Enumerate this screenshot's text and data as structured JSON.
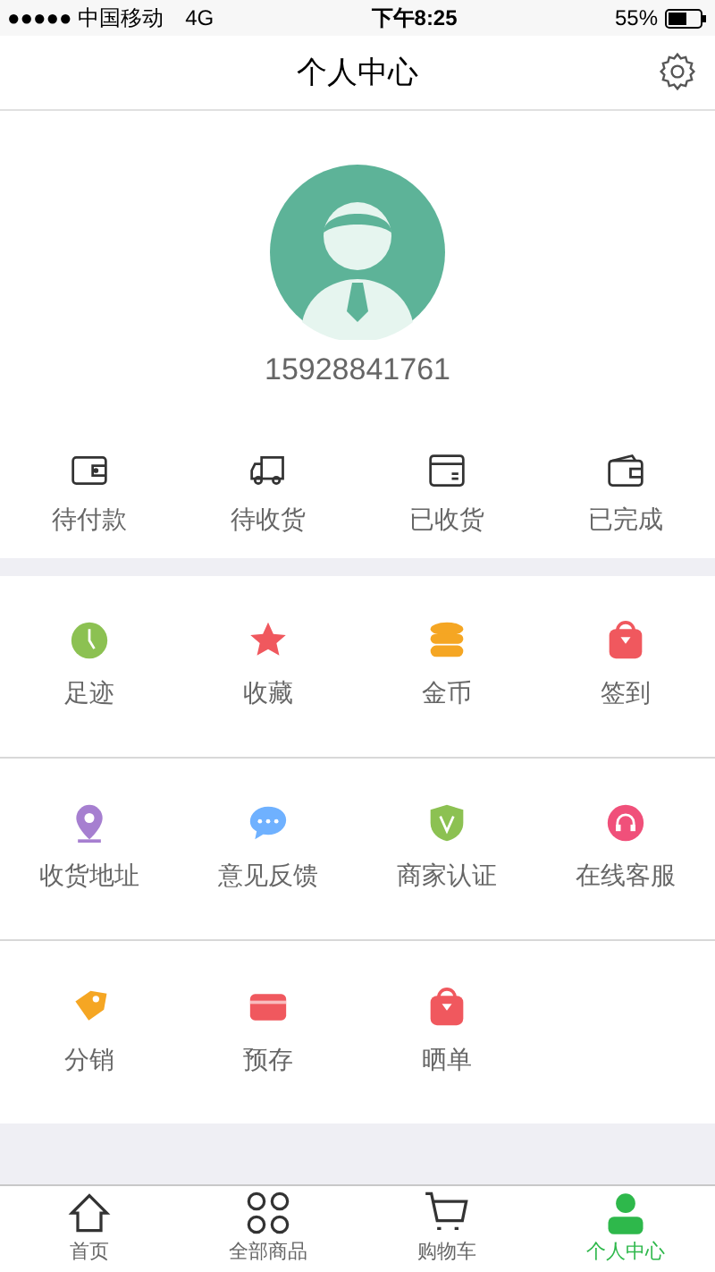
{
  "status_bar": {
    "carrier": "●●●●● 中国移动",
    "network": "4G",
    "time": "下午8:25",
    "battery": "55%"
  },
  "nav": {
    "title": "个人中心"
  },
  "profile": {
    "phone": "15928841761"
  },
  "orders": [
    {
      "label": "待付款"
    },
    {
      "label": "待收货"
    },
    {
      "label": "已收货"
    },
    {
      "label": "已完成"
    }
  ],
  "service_rows": [
    [
      {
        "label": "足迹",
        "color": "#8cc152"
      },
      {
        "label": "收藏",
        "color": "#f0585e"
      },
      {
        "label": "金币",
        "color": "#f5a623"
      },
      {
        "label": "签到",
        "color": "#f0585e"
      }
    ],
    [
      {
        "label": "收货地址",
        "color": "#a67fd0"
      },
      {
        "label": "意见反馈",
        "color": "#6fb1ff"
      },
      {
        "label": "商家认证",
        "color": "#8cc152"
      },
      {
        "label": "在线客服",
        "color": "#f0507a"
      }
    ],
    [
      {
        "label": "分销",
        "color": "#f5a623"
      },
      {
        "label": "预存",
        "color": "#f0585e"
      },
      {
        "label": "晒单",
        "color": "#f0585e"
      }
    ]
  ],
  "tabbar": [
    {
      "label": "首页",
      "selected": false
    },
    {
      "label": "全部商品",
      "selected": false
    },
    {
      "label": "购物车",
      "selected": false
    },
    {
      "label": "个人中心",
      "selected": true
    }
  ]
}
